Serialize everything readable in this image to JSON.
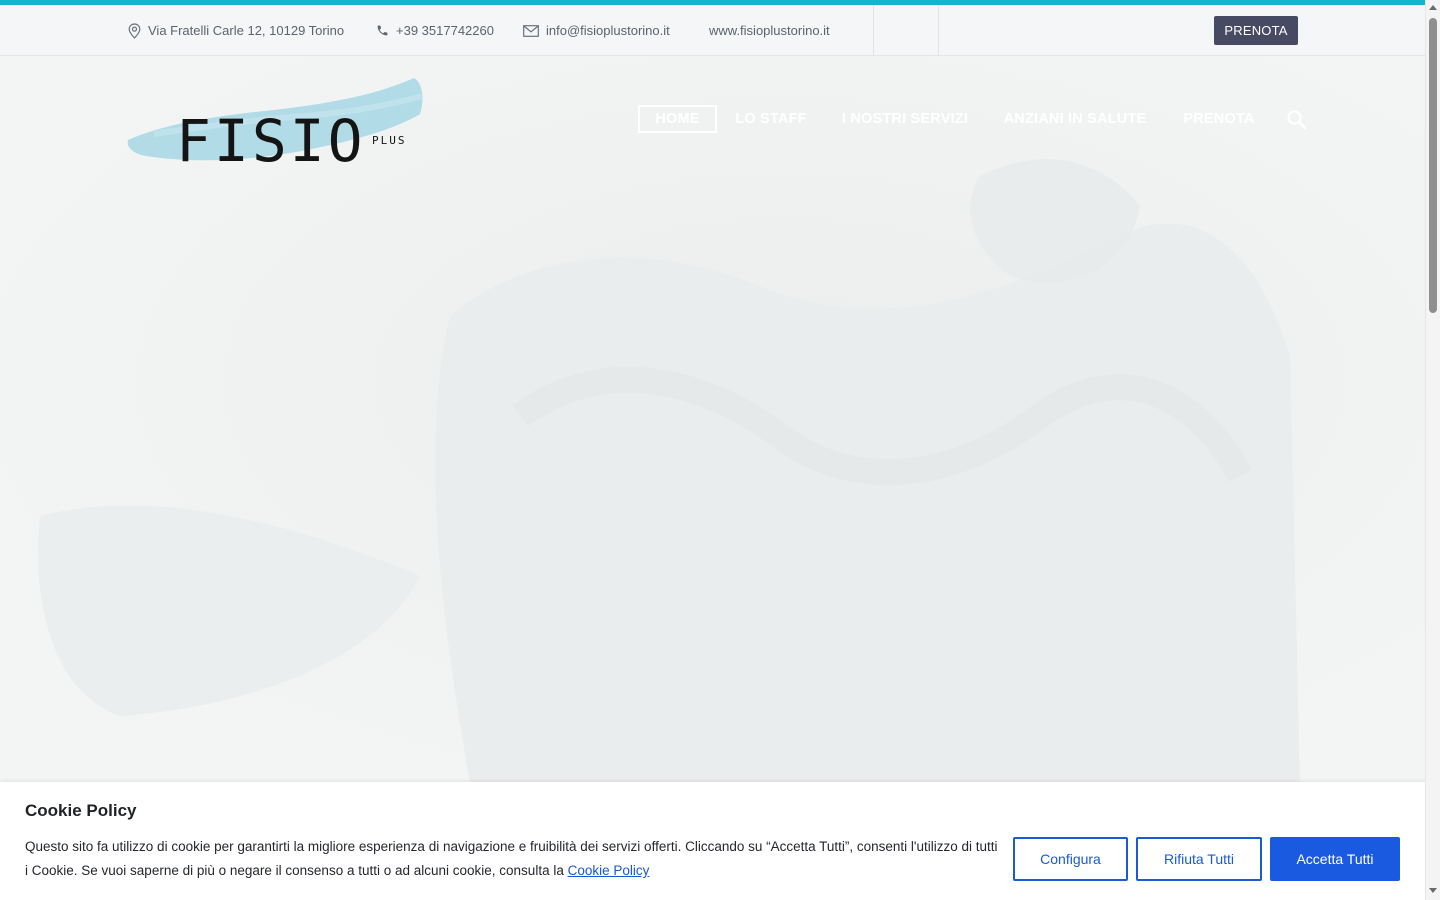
{
  "topbar": {
    "address": "Via Fratelli Carle 12, 10129 Torino",
    "phone": "+39 3517742260",
    "email": "info@fisioplustorino.it",
    "website": "www.fisioplustorino.it",
    "cta_label": "PRENOTA"
  },
  "logo": {
    "main": "FISIO",
    "sub": "PLUS"
  },
  "nav": {
    "items": [
      "HOME",
      "LO STAFF",
      "I NOSTRI SERVIZI",
      "ANZIANI IN SALUTE",
      "PRENOTA"
    ],
    "active": "HOME"
  },
  "cookie": {
    "title": "Cookie Policy",
    "text": "Questo sito fa utilizzo di cookie per garantirti la migliore esperienza di navigazione e fruibilità dei servizi offerti. Cliccando su “Accetta Tutti”, consenti l'utilizzo di tutti i Cookie. Se vuoi saperne di più o negare il consenso a tutti o ad alcuni cookie, consulta la",
    "link_label": "Cookie Policy",
    "configure_label": "Configura",
    "reject_label": "Rifiuta Tutti",
    "accept_label": "Accetta Tutti"
  },
  "colors": {
    "accent": "#11b6c8",
    "primary_button": "#1a5ae0",
    "topbar_button": "#474a63"
  }
}
